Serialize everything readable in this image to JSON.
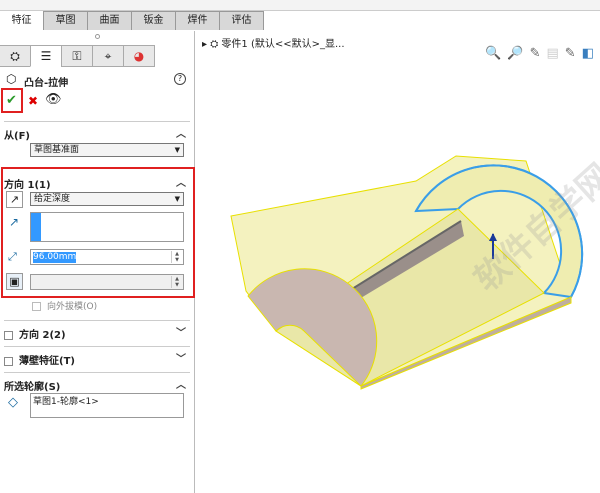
{
  "tabs": [
    "特征",
    "草图",
    "曲面",
    "钣金",
    "焊件",
    "评估"
  ],
  "panel": {
    "icon_tabs": [
      "feature-manager",
      "property-manager",
      "configuration-manager",
      "dimxpert-manager",
      "display-manager"
    ],
    "title": "凸台-拉伸",
    "help": "?",
    "from": {
      "label": "从(F)",
      "value": "草图基准面"
    },
    "dir1": {
      "label": "方向 1(1)",
      "end_condition": "给定深度",
      "depth": "96.00mm",
      "draft_outward": "向外拔模(O)"
    },
    "dir2": {
      "label": "方向 2(2)"
    },
    "thin": {
      "label": "薄壁特征(T)"
    },
    "contours": {
      "label": "所选轮廓(S)",
      "items": [
        "草图1-轮廓<1>"
      ]
    }
  },
  "tree": {
    "item": "零件1 (默认<<默认>_显..."
  },
  "watermark": "软件自学网 WWW.RJZXW.COM",
  "colors": {
    "accent": "#3399ff",
    "highlight": "#e02020",
    "body": "#f0eeb0",
    "edge": "#3a9ee8"
  }
}
